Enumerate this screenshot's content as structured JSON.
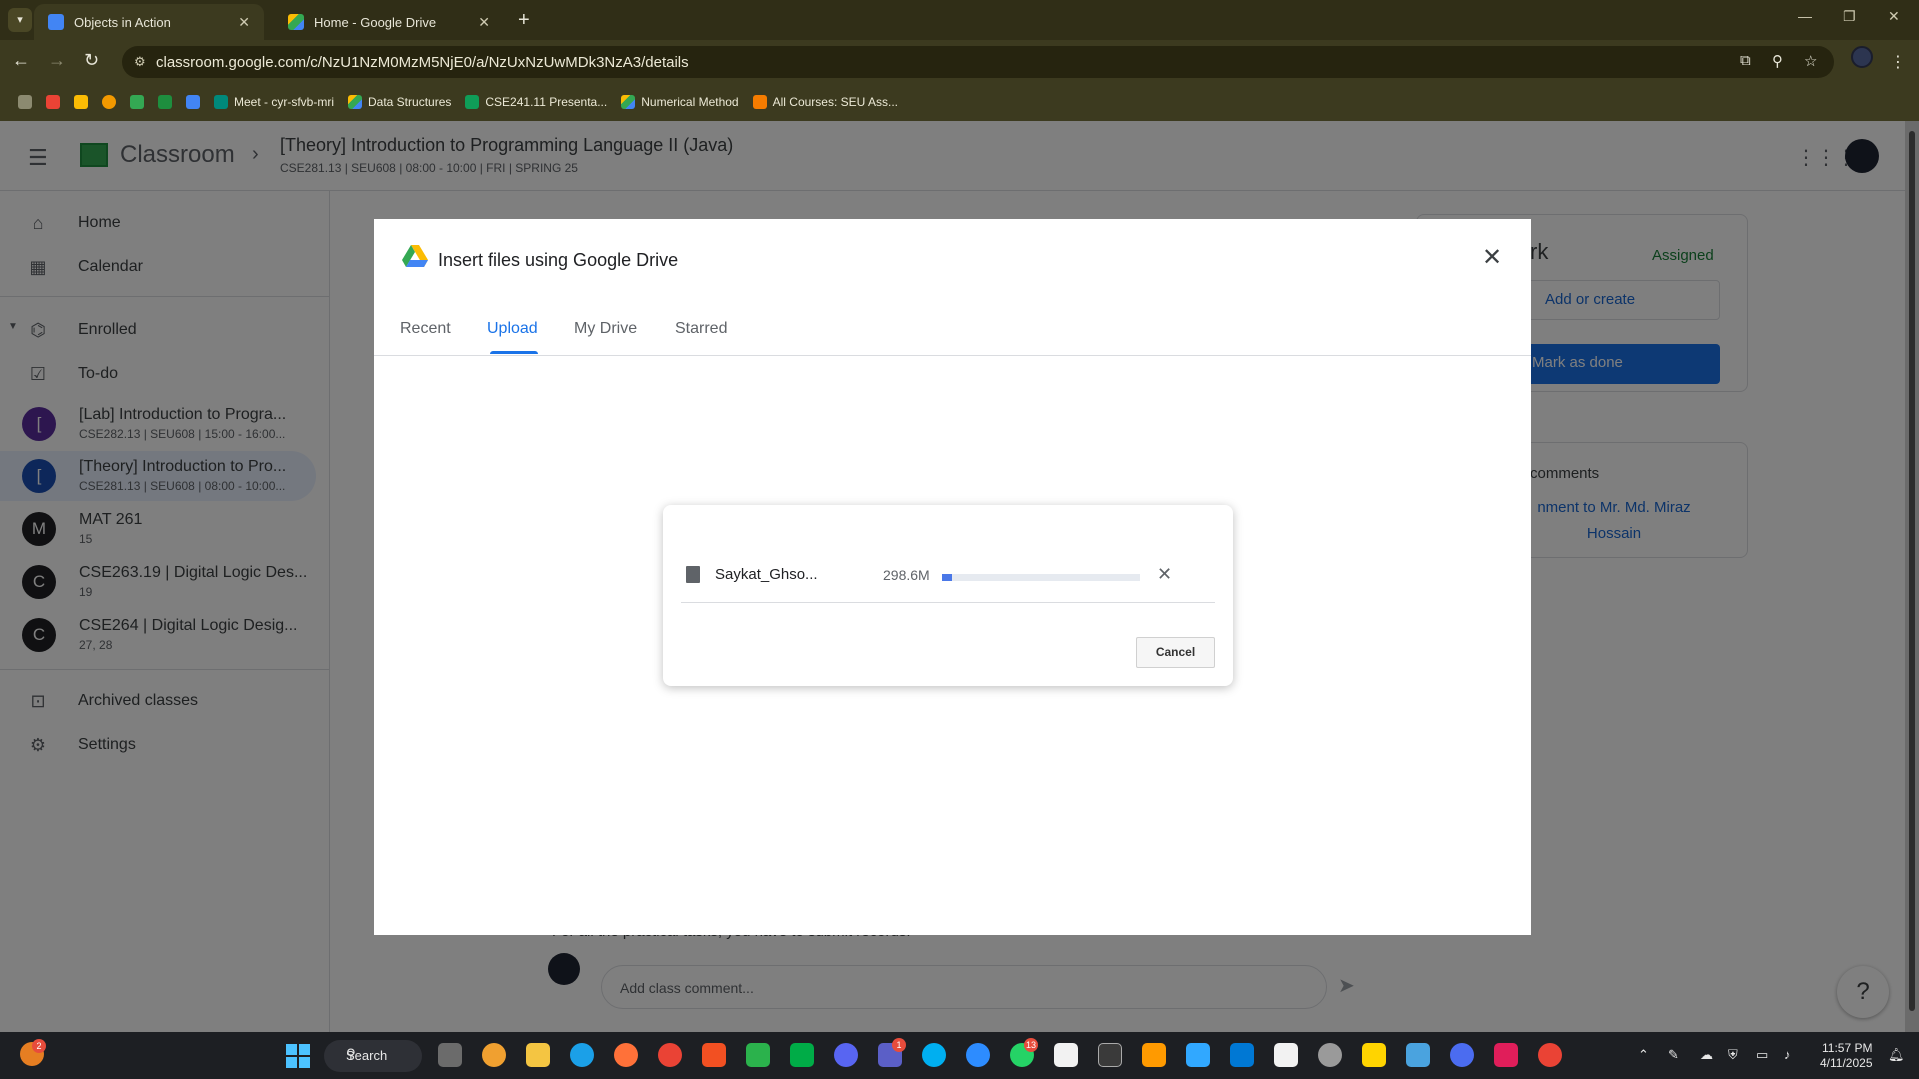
{
  "browser": {
    "tabs": [
      {
        "title": "Objects in Action",
        "active": true
      },
      {
        "title": "Home - Google Drive",
        "active": false
      }
    ],
    "url": "classroom.google.com/c/NzU1NzM0MzM5NjE0/a/NzUxNzUwMDk3NzA3/details",
    "bookmarks": [
      "Meet - cyr-sfvb-mri",
      "Data Structures",
      "CSE241.11 Presenta...",
      "Numerical Method",
      "All Courses: SEU Ass..."
    ]
  },
  "classroom": {
    "brand": "Classroom",
    "course_title": "[Theory] Introduction to Programming Language II (Java)",
    "course_sub": "CSE281.13 | SEU608 | 08:00 - 10:00 | FRI | SPRING 25",
    "nav": {
      "home": "Home",
      "calendar": "Calendar",
      "enrolled": "Enrolled",
      "todo": "To-do",
      "archived": "Archived classes",
      "settings": "Settings"
    },
    "classes": [
      {
        "initial": "[",
        "name": "[Lab] Introduction to Progra...",
        "sub": "CSE282.13 | SEU608 | 15:00 - 16:00...",
        "color": "#5b2d9e"
      },
      {
        "initial": "[",
        "name": "[Theory] Introduction to Pro...",
        "sub": "CSE281.13 | SEU608 | 08:00 - 10:00...",
        "color": "#1a4fb5"
      },
      {
        "initial": "M",
        "name": "MAT 261",
        "sub": "15",
        "color": "#202124"
      },
      {
        "initial": "C",
        "name": "CSE263.19 | Digital Logic Des...",
        "sub": "19",
        "color": "#202124"
      },
      {
        "initial": "C",
        "name": "CSE264 | Digital Logic Desig...",
        "sub": "27, 28",
        "color": "#202124"
      }
    ],
    "your_work": {
      "title_fragment": "rk",
      "status": "Assigned",
      "add_label": "Add or create",
      "mark_done_label": "Mark as done"
    },
    "private_comments": {
      "title_fragment": "comments",
      "link": "nment to Mr. Md. Miraz Hossain"
    },
    "stray_text": "For all the practical tasks, you have to submit records.",
    "comment_placeholder": "Add class comment..."
  },
  "picker": {
    "title": "Insert files using Google Drive",
    "tabs": [
      "Recent",
      "Upload",
      "My Drive",
      "Starred"
    ],
    "active_tab": "Upload",
    "upload": {
      "file_name": "Saykat_Ghso...",
      "file_size": "298.6M",
      "progress": 0.05,
      "cancel_label": "Cancel"
    }
  },
  "taskbar": {
    "search_label": "Search",
    "time": "11:57 PM",
    "date": "4/11/2025",
    "badges": {
      "left": "2",
      "teams": "1",
      "whatsapp": "13"
    }
  },
  "colors": {
    "accent": "#1a73e8",
    "assigned": "#188038",
    "progress": "#4a78e8"
  }
}
